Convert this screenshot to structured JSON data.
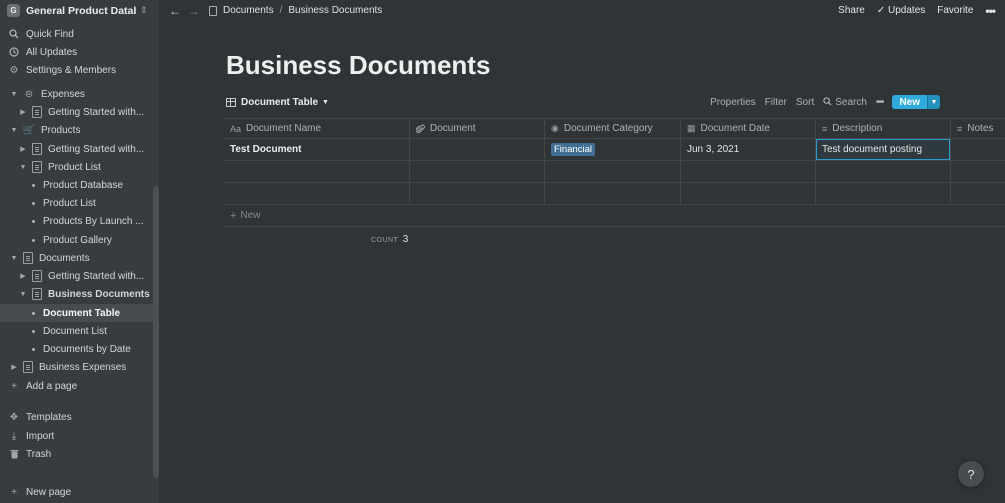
{
  "workspace": {
    "initial": "G",
    "name": "General Product Databa..."
  },
  "sidebar": {
    "top": [
      {
        "label": "Quick Find",
        "icon": "search-icon"
      },
      {
        "label": "All Updates",
        "icon": "clock-icon"
      },
      {
        "label": "Settings & Members",
        "icon": "gear-icon"
      }
    ],
    "tree": [
      {
        "label": "Expenses"
      },
      {
        "label": "Getting Started with..."
      },
      {
        "label": "Products"
      },
      {
        "label": "Getting Started with..."
      },
      {
        "label": "Product List"
      },
      {
        "label": "Product Database"
      },
      {
        "label": "Product List"
      },
      {
        "label": "Products By Launch ..."
      },
      {
        "label": "Product Gallery"
      },
      {
        "label": "Documents"
      },
      {
        "label": "Getting Started with..."
      },
      {
        "label": "Business Documents"
      },
      {
        "label": "Document Table"
      },
      {
        "label": "Document List"
      },
      {
        "label": "Documents by Date"
      },
      {
        "label": "Business Expenses"
      },
      {
        "label": "Add a page"
      }
    ],
    "bottom": [
      {
        "label": "Templates"
      },
      {
        "label": "Import"
      },
      {
        "label": "Trash"
      }
    ],
    "new_page": "New page"
  },
  "topbar": {
    "breadcrumbs": [
      "Documents",
      "Business Documents"
    ],
    "share": "Share",
    "updates": "Updates",
    "favorite": "Favorite",
    "more": "•••"
  },
  "page": {
    "title": "Business Documents"
  },
  "view": {
    "name": "Document Table",
    "actions": {
      "properties": "Properties",
      "filter": "Filter",
      "sort": "Sort",
      "search": "Search",
      "more": "•••",
      "new": "New"
    }
  },
  "table": {
    "columns": [
      {
        "label": "Document Name",
        "icon": "Aa"
      },
      {
        "label": "Document",
        "icon": "⊘"
      },
      {
        "label": "Document Category",
        "icon": "◉"
      },
      {
        "label": "Document Date",
        "icon": "▦"
      },
      {
        "label": "Description",
        "icon": "≡"
      },
      {
        "label": "Notes",
        "icon": "≡"
      }
    ],
    "rows": [
      {
        "name": "Test Document",
        "document": "",
        "category": "Financial",
        "date": "Jun 3, 2021",
        "description": "Test document posting",
        "notes": ""
      }
    ],
    "new_row": "New",
    "count_label": "COUNT",
    "count_value": "3"
  },
  "help": "?"
}
